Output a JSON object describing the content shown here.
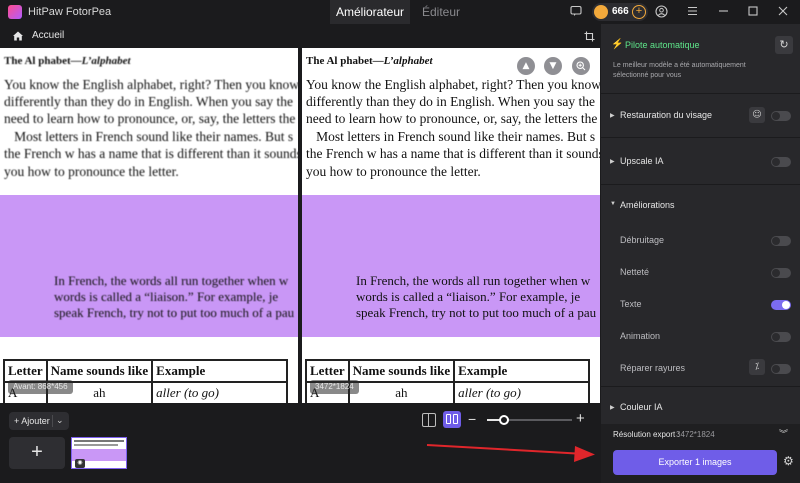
{
  "app": {
    "name": "HitPaw FotorPea"
  },
  "modes": {
    "active": "Améliorateur",
    "inactive": "Éditeur"
  },
  "credits": {
    "count": "666"
  },
  "breadcrumb": {
    "home": "Accueil"
  },
  "document": {
    "heading_plain": "The Al phabet—",
    "heading_italic": "L’alphabet",
    "lines": [
      "You know the English alphabet, right? Then you know",
      "differently than they do in English. When you say the",
      "need to learn how to pronounce, or, say, the letters the",
      "   Most letters in French sound like their names. But s",
      "the French w has a name that is different than it sounds",
      "you how to pronounce the letter."
    ],
    "lower_lines": [
      "In French, the words all run together when w",
      "words is called a “liaison.” For example, je",
      "speak French, try not to put too much of a pau"
    ],
    "table": {
      "headers": [
        "Letter",
        "Name sounds like",
        "Example"
      ],
      "row": [
        "A",
        "ah",
        "aller (to go)"
      ]
    }
  },
  "panes": {
    "before_label": "Avant: 868*456",
    "after_label": "3472*1824"
  },
  "bottom": {
    "add_label": "+ Ajouter",
    "zoom_level": 0.2
  },
  "panel": {
    "auto_title": "Pilote automatique",
    "auto_desc": "Le meilleur modèle a été automatiquement sélectionné pour vous",
    "sections": {
      "face": "Restauration du visage",
      "upscale": "Upscale IA",
      "improvements": "Améliorations",
      "color": "Couleur IA"
    },
    "options": {
      "denoise": "Débruitage",
      "sharpen": "Netteté",
      "text": "Texte",
      "animation": "Animation",
      "scratch": "Réparer rayures"
    },
    "resolution_label": "Résolution export :",
    "resolution_value": "3472*1824",
    "export_label": "Exporter 1 images"
  },
  "colors": {
    "accent": "#6f5de8",
    "auto_green": "#5ee68a",
    "lavender": "#c997f6",
    "arrow_red": "#e0262b"
  }
}
